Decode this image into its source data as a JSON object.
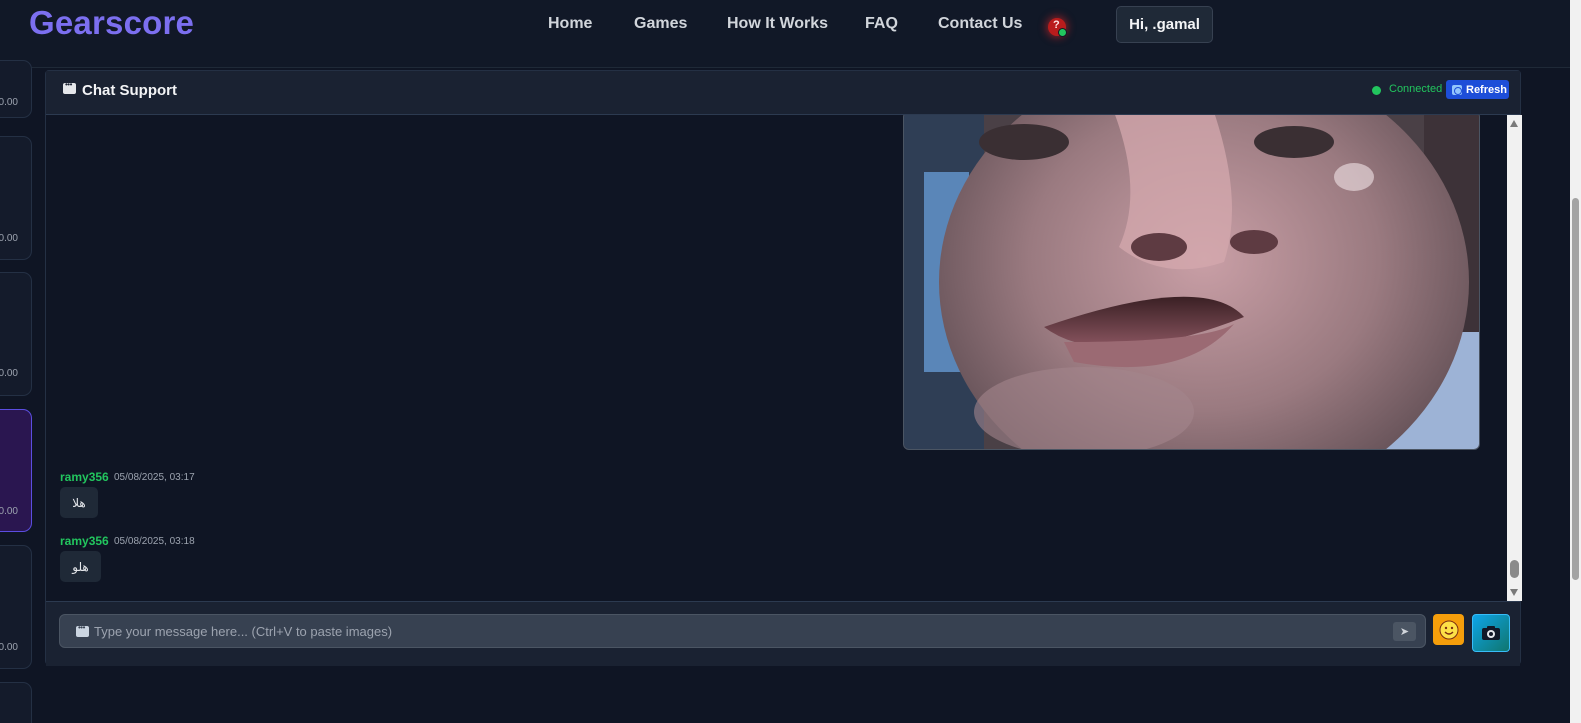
{
  "nav": {
    "brand": "Gearscore",
    "links": [
      "Home",
      "Games",
      "How It Works",
      "FAQ",
      "Contact Us"
    ],
    "user_greeting": "Hi, .gamal"
  },
  "rail": {
    "values": [
      "0.00",
      "0.00",
      "0.00",
      "0.00",
      "0.00"
    ]
  },
  "chat": {
    "title": "Chat Support",
    "status": "Connected",
    "refresh_label": "Refresh",
    "messages": [
      {
        "user": "ramy356",
        "time": "05/08/2025, 03:17",
        "text": "هلا"
      },
      {
        "user": "ramy356",
        "time": "05/08/2025, 03:18",
        "text": "هلو"
      }
    ],
    "input_placeholder": "Type your message here... (Ctrl+V to paste images)",
    "send_icon": "send-arrow-icon",
    "emoji_icon": "smiley-icon",
    "camera_icon": "camera-icon"
  },
  "colors": {
    "brand": "#7c6ff0",
    "connected": "#22c55e",
    "username": "#22c55e",
    "refresh": "#1d4ed8"
  }
}
